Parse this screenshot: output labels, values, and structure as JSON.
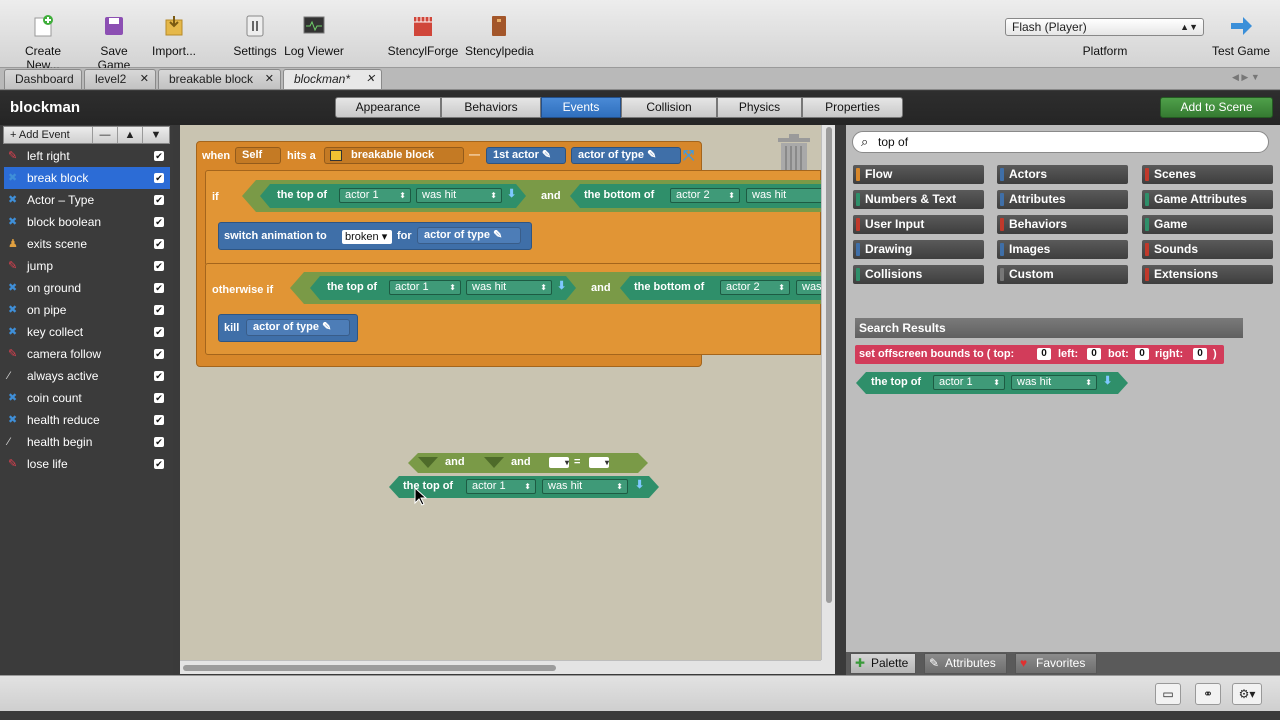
{
  "toolbar": {
    "create_new": "Create New...",
    "save_game": "Save Game",
    "import": "Import...",
    "settings": "Settings",
    "log_viewer": "Log Viewer",
    "stencylforge": "StencylForge",
    "stencylpedia": "Stencylpedia",
    "platform_value": "Flash (Player)",
    "platform_label": "Platform",
    "test_game": "Test Game"
  },
  "file_tabs": [
    "Dashboard",
    "level2",
    "breakable block",
    "blockman*"
  ],
  "header": {
    "title": "blockman",
    "tabs": [
      "Appearance",
      "Behaviors",
      "Events",
      "Collision",
      "Physics",
      "Properties"
    ],
    "active_tab": "Events",
    "add_to_scene": "Add to Scene"
  },
  "events_panel": {
    "add_event": "Add Event",
    "items": [
      {
        "label": "left right",
        "icon": "keyboard-icon"
      },
      {
        "label": "break block",
        "icon": "collision-icon",
        "selected": true
      },
      {
        "label": "Actor – Type",
        "icon": "collision-icon"
      },
      {
        "label": "block boolean",
        "icon": "collision-icon"
      },
      {
        "label": "exits scene",
        "icon": "actor-icon"
      },
      {
        "label": "jump",
        "icon": "keyboard-icon"
      },
      {
        "label": "on ground",
        "icon": "collision-icon"
      },
      {
        "label": "on pipe",
        "icon": "collision-icon"
      },
      {
        "label": "key collect",
        "icon": "collision-icon"
      },
      {
        "label": "camera follow",
        "icon": "keyboard-icon"
      },
      {
        "label": "always active",
        "icon": "wand-icon"
      },
      {
        "label": "coin count",
        "icon": "collision-icon"
      },
      {
        "label": "health reduce",
        "icon": "collision-icon"
      },
      {
        "label": "health begin",
        "icon": "wand-icon"
      },
      {
        "label": "lose life",
        "icon": "keyboard-icon"
      }
    ]
  },
  "canvas": {
    "when": "when",
    "self": "Self",
    "hits_a": "hits a",
    "breakable_block": "breakable block",
    "dash": "—",
    "first_actor": "1st actor",
    "actor_of_type": "actor of type",
    "if": "if",
    "the_top_of": "the top of",
    "actor1": "actor 1",
    "was_hit": "was hit",
    "and": "and",
    "the_bottom_of": "the bottom of",
    "actor2": "actor 2",
    "was_hit_trunc": "was",
    "switch_animation_to": "switch animation to",
    "broken": "broken",
    "for": "for",
    "otherwise_if": "otherwise if",
    "kill": "kill",
    "eq": "="
  },
  "palette": {
    "search_value": "top of",
    "categories": [
      {
        "label": "Flow",
        "color": "#d7872a"
      },
      {
        "label": "Actors",
        "color": "#3f6fa8"
      },
      {
        "label": "Scenes",
        "color": "#c0392b"
      },
      {
        "label": "Numbers & Text",
        "color": "#2f8f6a"
      },
      {
        "label": "Attributes",
        "color": "#3f6fa8"
      },
      {
        "label": "Game Attributes",
        "color": "#2f8f6a"
      },
      {
        "label": "User Input",
        "color": "#c0392b"
      },
      {
        "label": "Behaviors",
        "color": "#c0392b"
      },
      {
        "label": "Game",
        "color": "#2f8f6a"
      },
      {
        "label": "Drawing",
        "color": "#3f6fa8"
      },
      {
        "label": "Images",
        "color": "#3f6fa8"
      },
      {
        "label": "Sounds",
        "color": "#c0392b"
      },
      {
        "label": "Collisions",
        "color": "#2f8f6a"
      },
      {
        "label": "Custom",
        "color": "#777777"
      },
      {
        "label": "Extensions",
        "color": "#c0392b"
      }
    ],
    "search_results": "Search Results",
    "result1": {
      "text": "set offscreen bounds to ( top:",
      "left": "left:",
      "bot": "bot:",
      "right": "right:",
      "end": ")",
      "zero": "0"
    },
    "result2": {
      "text": "the top of",
      "actor": "actor 1",
      "hit": "was hit"
    },
    "tabs": [
      "Palette",
      "Attributes",
      "Favorites"
    ]
  }
}
